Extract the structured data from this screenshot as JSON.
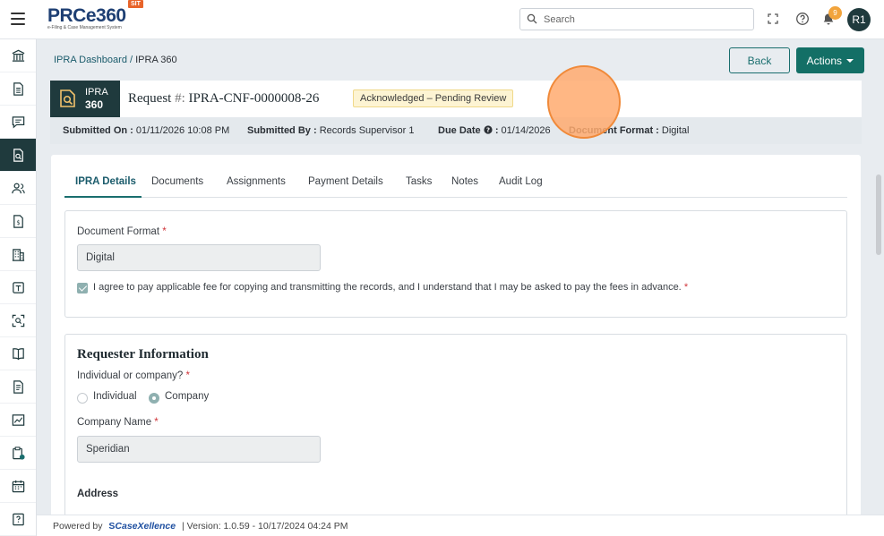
{
  "topbar": {
    "logo_main": "PRCe360",
    "logo_sub": "e-Filing & Case Management System",
    "env_badge": "SIT",
    "search_placeholder": "Search",
    "notification_count": "9",
    "avatar_initials": "R1"
  },
  "sidebar": {
    "items": [
      {
        "icon": "bank-icon"
      },
      {
        "icon": "document-icon"
      },
      {
        "icon": "chat-icon"
      },
      {
        "icon": "document-search-icon",
        "active": true
      },
      {
        "icon": "users-icon"
      },
      {
        "icon": "money-document-icon"
      },
      {
        "icon": "building-icon"
      },
      {
        "icon": "form-icon"
      },
      {
        "icon": "scan-icon"
      },
      {
        "icon": "book-icon"
      },
      {
        "icon": "file-text-icon"
      },
      {
        "icon": "chart-icon"
      },
      {
        "icon": "clipboard-icon"
      },
      {
        "icon": "calendar-icon"
      },
      {
        "icon": "help-document-icon"
      }
    ]
  },
  "breadcrumb": {
    "parent": "IPRA Dashboard",
    "separator": "/",
    "current": "IPRA 360"
  },
  "actions": {
    "back_label": "Back",
    "actions_label": "Actions"
  },
  "request": {
    "tile_line1": "IPRA",
    "tile_line2": "360",
    "title_prefix": "Request",
    "title_hash": "#:",
    "title_id": "IPRA-CNF-0000008-26",
    "status": "Acknowledged – Pending Review"
  },
  "meta": {
    "submitted_on_label": "Submitted On :",
    "submitted_on_value": "01/11/2026 10:08 PM",
    "submitted_by_label": "Submitted By :",
    "submitted_by_value": "Records Supervisor 1",
    "due_date_label": "Due Date",
    "due_date_colon": ":",
    "due_date_value": "01/14/2026",
    "doc_format_label": "Document Format :",
    "doc_format_value": "Digital"
  },
  "tabs": [
    "IPRA Details",
    "Documents",
    "Assignments",
    "Payment Details",
    "Tasks",
    "Notes",
    "Audit Log"
  ],
  "document_section": {
    "format_label": "Document Format",
    "format_value": "Digital",
    "agree_text": "I agree to pay applicable fee for copying and transmitting the records, and I understand that I may be asked to pay the fees in advance."
  },
  "requester": {
    "title": "Requester Information",
    "type_label": "Individual or company?",
    "option_individual": "Individual",
    "option_company": "Company",
    "selected": "Company",
    "company_name_label": "Company Name",
    "company_name_value": "Speridian",
    "address_label": "Address"
  },
  "footer": {
    "powered_by": "Powered by",
    "brand": "CaseXellence",
    "version": "|  Version: 1.0.59 - 10/17/2024 04:24 PM"
  },
  "colors": {
    "brand_dark": "#1f3a3d",
    "accent": "#136f66",
    "status_bg": "#fdf4d3",
    "notification": "#f2a43c"
  }
}
